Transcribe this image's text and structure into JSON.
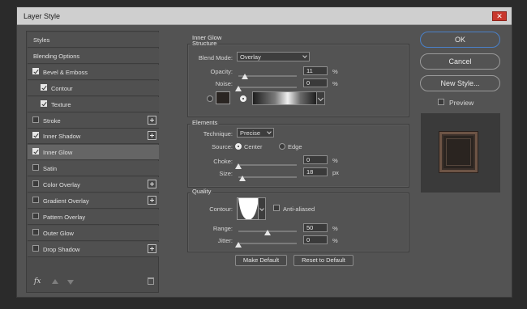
{
  "window": {
    "title": "Layer Style",
    "close_label": "✕"
  },
  "styles_list": [
    {
      "label": "Styles",
      "checkbox": null,
      "plus": false,
      "indent": false,
      "selected": false
    },
    {
      "label": "Blending Options",
      "checkbox": null,
      "plus": false,
      "indent": false,
      "selected": false
    },
    {
      "label": "Bevel & Emboss",
      "checkbox": true,
      "plus": false,
      "indent": false,
      "selected": false
    },
    {
      "label": "Contour",
      "checkbox": true,
      "plus": false,
      "indent": true,
      "selected": false
    },
    {
      "label": "Texture",
      "checkbox": true,
      "plus": false,
      "indent": true,
      "selected": false
    },
    {
      "label": "Stroke",
      "checkbox": false,
      "plus": true,
      "indent": false,
      "selected": false
    },
    {
      "label": "Inner Shadow",
      "checkbox": true,
      "plus": true,
      "indent": false,
      "selected": false
    },
    {
      "label": "Inner Glow",
      "checkbox": true,
      "plus": false,
      "indent": false,
      "selected": true
    },
    {
      "label": "Satin",
      "checkbox": false,
      "plus": false,
      "indent": false,
      "selected": false
    },
    {
      "label": "Color Overlay",
      "checkbox": false,
      "plus": true,
      "indent": false,
      "selected": false
    },
    {
      "label": "Gradient Overlay",
      "checkbox": false,
      "plus": true,
      "indent": false,
      "selected": false
    },
    {
      "label": "Pattern Overlay",
      "checkbox": false,
      "plus": false,
      "indent": false,
      "selected": false
    },
    {
      "label": "Outer Glow",
      "checkbox": false,
      "plus": false,
      "indent": false,
      "selected": false
    },
    {
      "label": "Drop Shadow",
      "checkbox": false,
      "plus": true,
      "indent": false,
      "selected": false
    }
  ],
  "footer_icons": {
    "fx": "fx",
    "up": "arrow-up-icon",
    "down": "arrow-down-icon",
    "trash": "trash-icon"
  },
  "inner_glow": {
    "heading": "Inner Glow",
    "structure": {
      "title": "Structure",
      "blend_mode_label": "Blend Mode:",
      "blend_mode_value": "Overlay",
      "opacity_label": "Opacity:",
      "opacity_value": "11",
      "opacity_unit": "%",
      "opacity_level": 11,
      "noise_label": "Noise:",
      "noise_value": "0",
      "noise_unit": "%",
      "noise_level": 0,
      "color_radio_selected": false,
      "gradient_radio_selected": true,
      "color_swatch": "#2a2522"
    },
    "elements": {
      "title": "Elements",
      "technique_label": "Technique:",
      "technique_value": "Precise",
      "source_label": "Source:",
      "source_center": "Center",
      "source_edge": "Edge",
      "source_selected": "Center",
      "choke_label": "Choke:",
      "choke_value": "0",
      "choke_unit": "%",
      "choke_level": 0,
      "size_label": "Size:",
      "size_value": "18",
      "size_unit": "px",
      "size_level": 7
    },
    "quality": {
      "title": "Quality",
      "contour_label": "Contour:",
      "anti_aliased_label": "Anti-aliased",
      "anti_aliased_checked": false,
      "range_label": "Range:",
      "range_value": "50",
      "range_unit": "%",
      "range_level": 50,
      "jitter_label": "Jitter:",
      "jitter_value": "0",
      "jitter_unit": "%",
      "jitter_level": 0
    },
    "make_default_label": "Make Default",
    "reset_default_label": "Reset to Default"
  },
  "actions": {
    "ok_label": "OK",
    "cancel_label": "Cancel",
    "new_style_label": "New Style...",
    "preview_label": "Preview",
    "preview_checked": false
  },
  "colors": {
    "accent": "#4a80c8",
    "close": "#c8372c",
    "panel": "#535353"
  }
}
